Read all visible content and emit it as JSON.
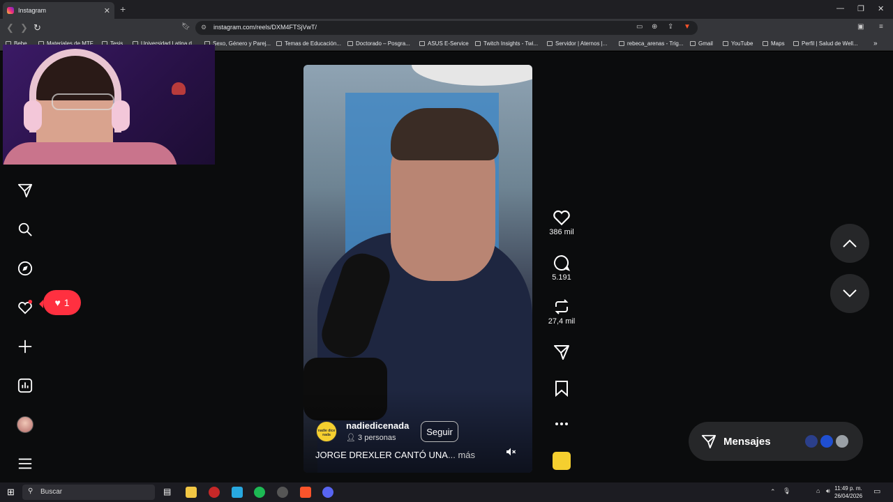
{
  "browser": {
    "tab_title": "Instagram",
    "new_tab": "+",
    "url": "instagram.com/reels/DXM4FTSjVwT/",
    "bookmarks": [
      "Bebe",
      "Materiales de MTF",
      "Tesis",
      "Universidad Latina d...",
      "Sexo, Género y Parej...",
      "Temas de Educación...",
      "Doctorado – Posgra...",
      "ASUS E-Service",
      "Twitch Insights - Twi...",
      "Servidor | Aternos |...",
      "rebeca_arenas - Trig...",
      "Gmail",
      "YouTube",
      "Maps",
      "Perfil | Salud de Well..."
    ]
  },
  "sidebar": {
    "notification_count": "1"
  },
  "reel": {
    "username": "nadiedicenada",
    "avatar_text": "nadie dice nada",
    "collab": "3 personas",
    "follow_label": "Seguir",
    "caption": "JORGE DREXLER CANTÓ UNA",
    "more_label": "... más"
  },
  "actions": {
    "likes": "386 mil",
    "comments": "5.191",
    "reposts": "27,4 mil"
  },
  "messages": {
    "label": "Mensajes"
  },
  "taskbar": {
    "search_placeholder": "Buscar",
    "time": "11:49 p. m.",
    "date": "26/04/2026"
  },
  "colors": {
    "accent_red": "#ff3040",
    "panel": "#262729",
    "page_bg": "#0b0c0d"
  }
}
